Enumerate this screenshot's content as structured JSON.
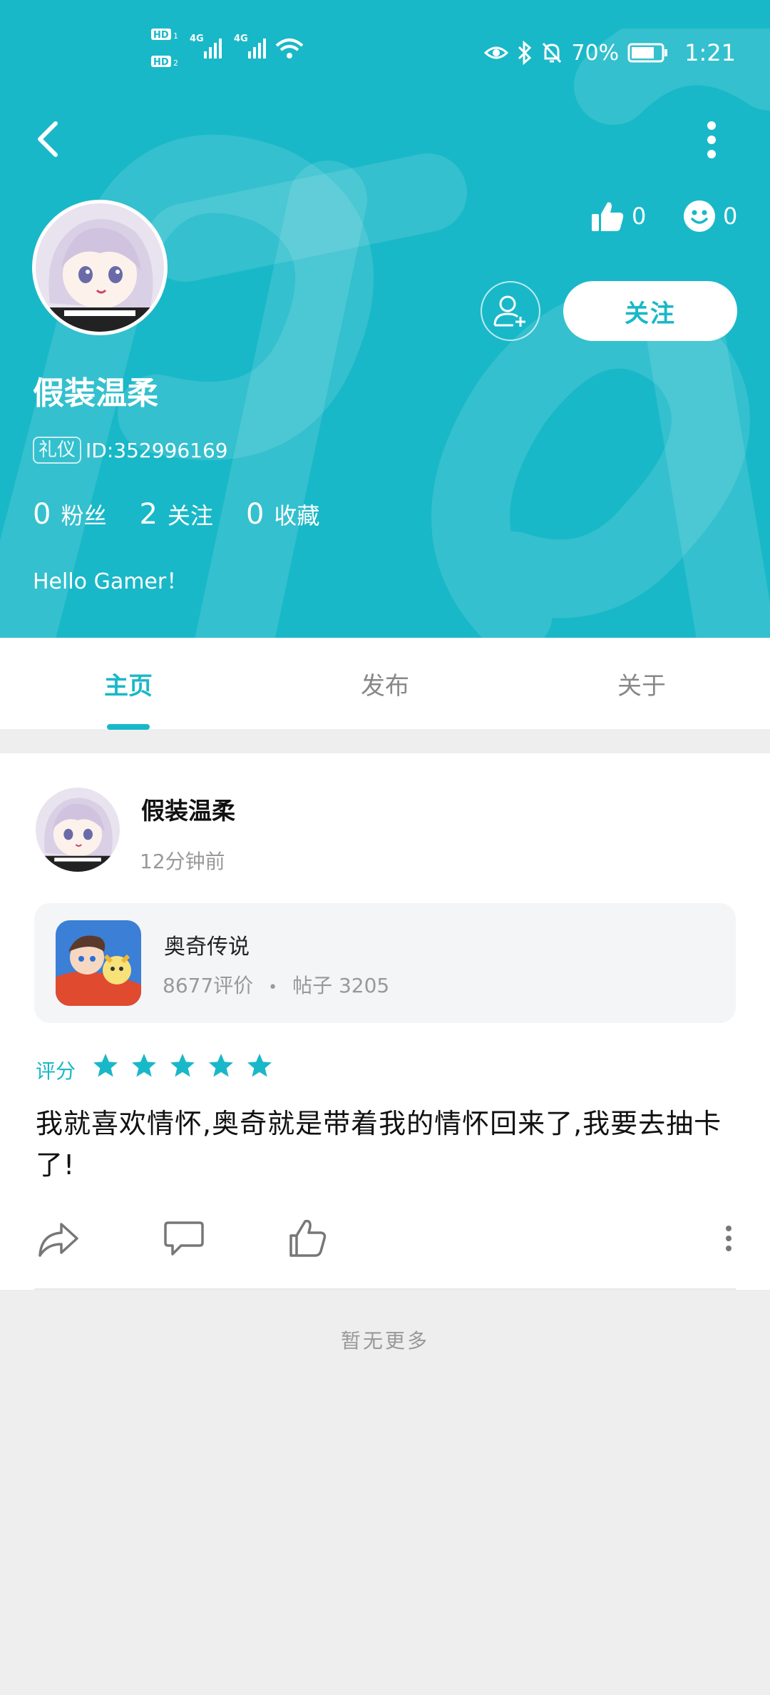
{
  "status_bar": {
    "network": "HD1 HD2 4G 4G",
    "battery_percent": "70%",
    "time": "1:21"
  },
  "header": {
    "likes": "0",
    "faces": "0",
    "follow_button": "关注",
    "username": "假装温柔",
    "badge": "礼仪",
    "user_id": "ID:352996169",
    "counts": [
      {
        "num": "0",
        "label": "粉丝"
      },
      {
        "num": "2",
        "label": "关注"
      },
      {
        "num": "0",
        "label": "收藏"
      }
    ],
    "bio": "Hello Gamer！"
  },
  "tabs": [
    "主页",
    "发布",
    "关于"
  ],
  "post": {
    "author": "假装温柔",
    "time": "12分钟前",
    "game": {
      "name": "奥奇传说",
      "reviews": "8677评价",
      "separator": "•",
      "posts": "帖子 3205"
    },
    "rating_label": "评分",
    "stars": 5,
    "text": "我就喜欢情怀,奥奇就是带着我的情怀回来了,我要去抽卡了!"
  },
  "footer": {
    "no_more": "暂无更多"
  },
  "colors": {
    "accent": "#19b8c8",
    "background": "#eeeeee"
  }
}
